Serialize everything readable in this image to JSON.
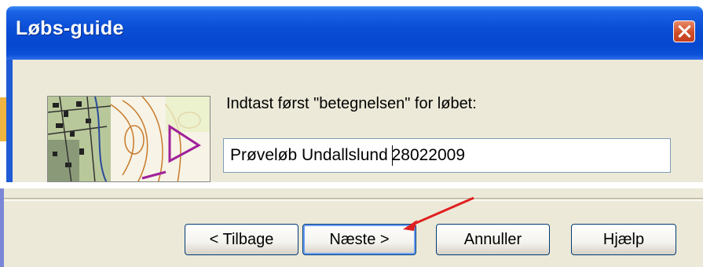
{
  "window": {
    "title": "Løbs-guide",
    "close_icon": "close-icon"
  },
  "content": {
    "prompt": "Indtast først \"betegnelsen\" for løbet:",
    "name_value_before_caret": "Prøveløb Undallslund ",
    "name_value_after_caret": "28022009",
    "map_icon": "orienteering-map-image"
  },
  "buttons": {
    "back": "< Tilbage",
    "next": "Næste >",
    "cancel": "Annuller",
    "help": "Hjælp"
  },
  "annotation": {
    "arrow_color": "#e02020",
    "arrow_icon": "red-arrow-annotation"
  },
  "colors": {
    "titlebar": "#0a4fd6",
    "dialog_bg": "#ece9d8"
  }
}
